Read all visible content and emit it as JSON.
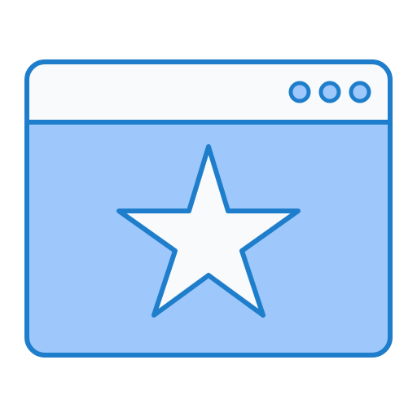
{
  "icon": {
    "name": "browser-window-star-icon",
    "parts": {
      "window": "browser-window-icon",
      "title_bar": "title-bar",
      "controls": [
        "window-dot-icon",
        "window-dot-icon",
        "window-dot-icon"
      ],
      "star": "star-icon"
    }
  },
  "colors": {
    "stroke": "#1f7ecb",
    "content_fill": "#9ec8fb",
    "title_bar_fill": "#f8fafc",
    "dot_fill": "#9ec8fb",
    "star_fill": "#f8fafc",
    "background": "#ffffff"
  }
}
